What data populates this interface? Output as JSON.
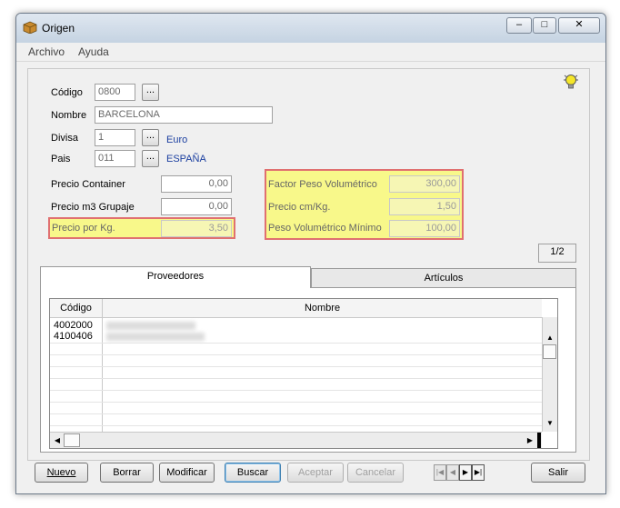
{
  "window": {
    "title": "Origen",
    "minimize": "–",
    "maximize": "□",
    "close": "✕"
  },
  "menu": {
    "archivo": "Archivo",
    "ayuda": "Ayuda"
  },
  "form": {
    "codigo_label": "Código",
    "codigo_value": "0800",
    "nombre_label": "Nombre",
    "nombre_value": "BARCELONA",
    "divisa_label": "Divisa",
    "divisa_value": "1",
    "divisa_name": "Euro",
    "pais_label": "Pais",
    "pais_value": "011",
    "pais_name": "ESPAÑA",
    "dots": "...",
    "precio_container_label": "Precio Container",
    "precio_container_value": "0,00",
    "precio_m3_label": "Precio m3 Grupaje",
    "precio_m3_value": "0,00",
    "precio_kg_label": "Precio por Kg.",
    "precio_kg_value": "3,50",
    "factor_label": "Factor Peso Volumétrico",
    "factor_value": "300,00",
    "precio_cm_label": "Precio cm/Kg.",
    "precio_cm_value": "1,50",
    "peso_min_label": "Peso Volumétrico Mínimo",
    "peso_min_value": "100,00",
    "page_indicator": "1/2"
  },
  "tabs": {
    "proveedores": "Proveedores",
    "articulos": "Artículos"
  },
  "grid": {
    "col_codigo": "Código",
    "col_nombre": "Nombre",
    "rows": [
      {
        "codigo": "4002000"
      },
      {
        "codigo": "4100406"
      }
    ]
  },
  "buttons": {
    "nuevo": "Nuevo",
    "borrar": "Borrar",
    "modificar": "Modificar",
    "buscar": "Buscar",
    "aceptar": "Aceptar",
    "cancelar": "Cancelar",
    "salir": "Salir"
  },
  "nav": {
    "first": "|◀",
    "prev": "◀",
    "next": "▶",
    "last": "▶|"
  },
  "icons": {
    "app": "package-icon",
    "hint": "lightbulb-icon"
  },
  "colors": {
    "highlight": "#f8f88a",
    "highlight_border": "#e07070",
    "link": "#1b3fa0"
  }
}
